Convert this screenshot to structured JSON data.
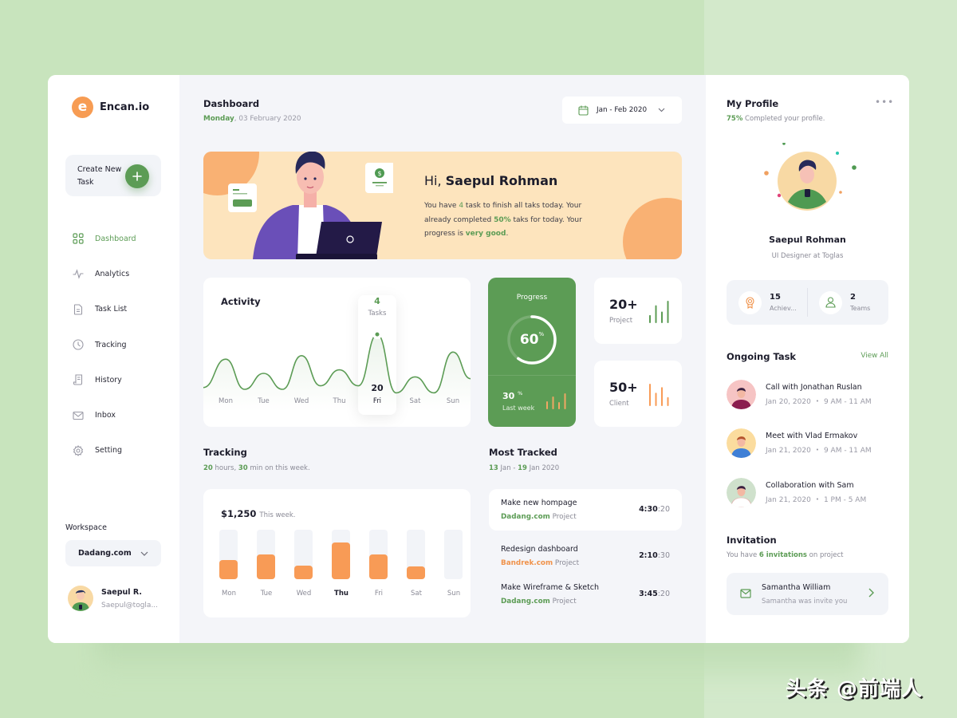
{
  "brand": {
    "logo_letter": "e",
    "name": "Encan.io"
  },
  "sidebar": {
    "create": {
      "label": "Create New Task",
      "button_icon": "plus-icon"
    },
    "items": [
      {
        "label": "Dashboard",
        "icon": "grid-icon",
        "active": true
      },
      {
        "label": "Analytics",
        "icon": "pulse-icon",
        "active": false
      },
      {
        "label": "Task List",
        "icon": "document-icon",
        "active": false
      },
      {
        "label": "Tracking",
        "icon": "clock-icon",
        "active": false
      },
      {
        "label": "History",
        "icon": "receipt-icon",
        "active": false
      },
      {
        "label": "Inbox",
        "icon": "mail-icon",
        "active": false
      },
      {
        "label": "Setting",
        "icon": "gear-icon",
        "active": false
      }
    ],
    "workspace": {
      "title": "Workspace",
      "selected": "Dadang.com"
    },
    "user": {
      "name": "Saepul R.",
      "email": "Saepul@togla..."
    }
  },
  "header": {
    "title": "Dashboard",
    "date_day": "Monday",
    "date_rest": ", 03 February 2020",
    "date_range": "Jan - Feb 2020"
  },
  "hero": {
    "greeting_prefix": "Hi, ",
    "greeting_name": "Saepul Rohman",
    "line1_a": "You have ",
    "task_count": "4",
    "line1_b": " task to finish all taks today. Your already completed ",
    "completed_pct": "50%",
    "line1_c": " taks for today. Your progress is ",
    "progress_word": "very good",
    "line1_d": "."
  },
  "activity": {
    "title": "Activity",
    "highlight": {
      "value": "4",
      "unit": "Tasks",
      "date": "20",
      "day": "Fri"
    }
  },
  "chart_data": [
    {
      "type": "line",
      "title": "Activity",
      "categories": [
        "Mon",
        "Tue",
        "Wed",
        "Thu",
        "Fri",
        "Sat",
        "Sun"
      ],
      "series": [
        {
          "name": "Tasks",
          "values": [
            2.6,
            1.8,
            2.8,
            2.0,
            4.0,
            1.6,
            3.0
          ]
        }
      ],
      "highlight": {
        "category": "Fri",
        "value": 4
      },
      "ylim": [
        0,
        4.5
      ],
      "grid": false
    },
    {
      "type": "bar",
      "title": "$1,250 This week.",
      "categories": [
        "Mon",
        "Tue",
        "Wed",
        "Thu",
        "Fri",
        "Sat",
        "Sun"
      ],
      "values": [
        0.38,
        0.5,
        0.27,
        0.74,
        0.5,
        0.26,
        0
      ],
      "highlight": "Thu",
      "ylim": [
        0,
        1
      ]
    }
  ],
  "progress": {
    "title": "Progress",
    "value": 60,
    "value_label": "60",
    "pct_symbol": "%",
    "last_week_value": "30",
    "last_week_label": "Last week",
    "mini_bars": [
      0.5,
      0.8,
      0.45,
      1.0
    ]
  },
  "stats": [
    {
      "value": "20+",
      "label": "Project",
      "color": "#5c9c55",
      "bars": [
        0.45,
        1.0,
        0.65,
        1.25
      ]
    },
    {
      "value": "50+",
      "label": "Client",
      "color": "#f89b56",
      "bars": [
        1.0,
        0.6,
        0.85,
        0.4
      ]
    }
  ],
  "tracking": {
    "title": "Tracking",
    "hours": "20",
    "hours_label": " hours, ",
    "mins": "30",
    "mins_label": " min on this week.",
    "amount": "$1,250",
    "amount_label": "This week."
  },
  "most_tracked": {
    "title": "Most Tracked",
    "from_day": "13",
    "from_rest": " Jan - ",
    "to_day": "19",
    "to_rest": " Jan 2020",
    "items": [
      {
        "name": "Make new hompage",
        "project": "Dadang.com",
        "project_suffix": " Project",
        "time_main": "4:30",
        "time_sec": ":20",
        "project_color": "green",
        "selected": true
      },
      {
        "name": "Redesign dashboard",
        "project": "Bandrek.com",
        "project_suffix": " Project",
        "time_main": "2:10",
        "time_sec": ":30",
        "project_color": "orange",
        "selected": false
      },
      {
        "name": "Make Wireframe & Sketch",
        "project": "Dadang.com",
        "project_suffix": " Project",
        "time_main": "3:45",
        "time_sec": ":20",
        "project_color": "green",
        "selected": false
      }
    ]
  },
  "profile": {
    "title": "My Profile",
    "completion": "75%",
    "completion_label": " Completed your profile.",
    "completion_value": 0.75,
    "name": "Saepul Rohman",
    "role": "UI Designer at Toglas",
    "achievements": {
      "value": "15",
      "label": "Achiev..."
    },
    "teams": {
      "value": "2",
      "label": "Teams"
    }
  },
  "ongoing": {
    "title": "Ongoing Task",
    "view_all": "View All",
    "tasks": [
      {
        "name": "Call with Jonathan Ruslan",
        "date": "Jan 20, 2020",
        "time": "9 AM - 11 AM",
        "avatar_bg": "#f6c4c4",
        "shirt": "#8b1d4f"
      },
      {
        "name": "Meet with Vlad Ermakov",
        "date": "Jan 21, 2020",
        "time": "9 AM - 11 AM",
        "avatar_bg": "#fbdc9e",
        "shirt": "#3f7fd6"
      },
      {
        "name": "Collaboration with Sam",
        "date": "Jan 21, 2020",
        "time": "1 PM - 5 AM",
        "avatar_bg": "#cfe1cc",
        "shirt": "#ffffff"
      }
    ]
  },
  "invitation": {
    "title": "Invitation",
    "sub_a": "You have ",
    "count": "6 invitations",
    "sub_b": " on project",
    "card": {
      "name": "Samantha William",
      "message": "Samantha was invite you"
    }
  },
  "watermark": "头条 @前端人",
  "colors": {
    "accent_green": "#5c9c55",
    "accent_orange": "#f89b56",
    "hero_bg": "#fde4bd",
    "main_bg": "#f4f5f9"
  }
}
